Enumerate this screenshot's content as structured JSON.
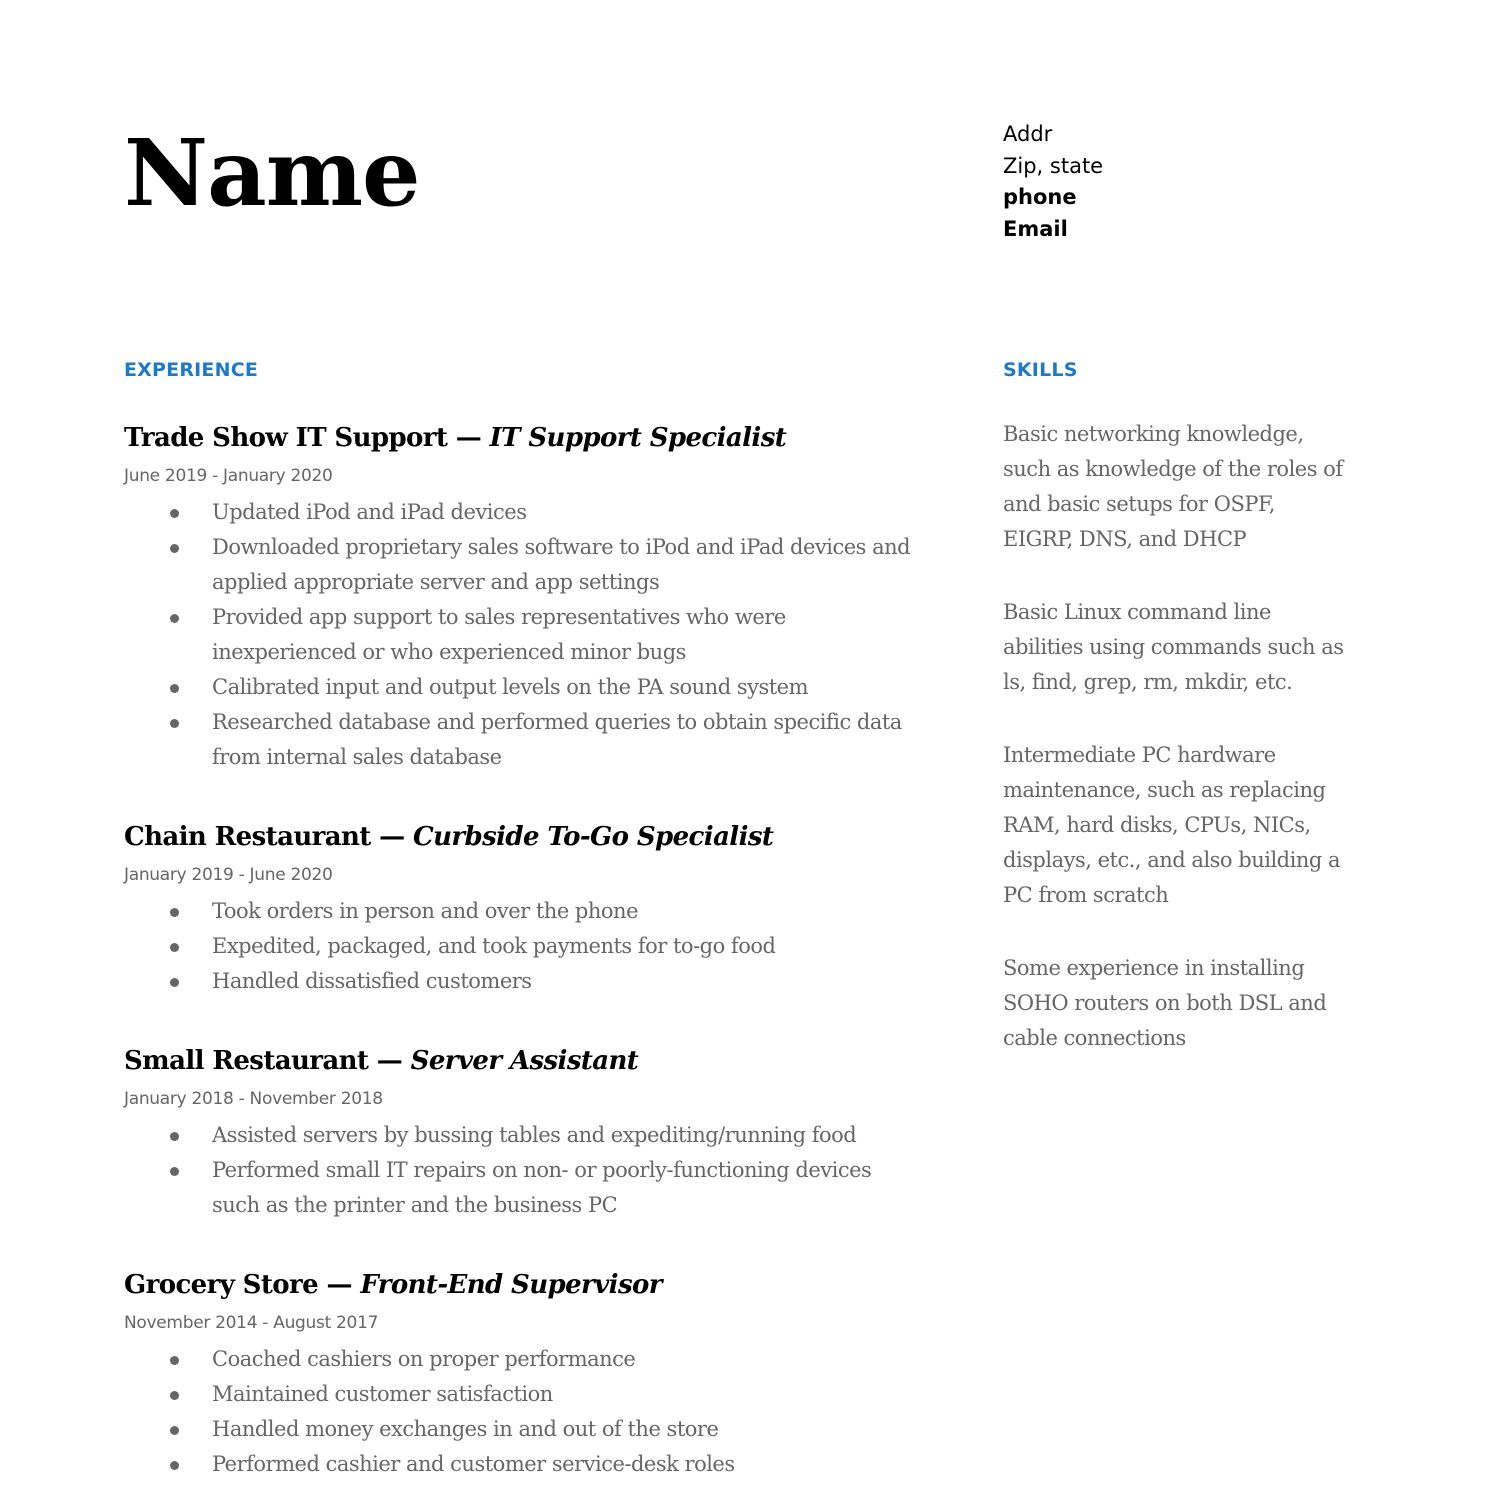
{
  "header": {
    "name": "Name",
    "contact": {
      "address": "Addr",
      "zip_state": "Zip, state",
      "phone": "phone",
      "email": "Email"
    }
  },
  "colors": {
    "accent": "#2079c7",
    "body_text": "#666666",
    "heading_text": "#000000"
  },
  "experience": {
    "heading": "EXPERIENCE",
    "separator": " — ",
    "jobs": [
      {
        "company": "Trade Show IT Support",
        "role": "IT Support Specialist",
        "dates": "June 2019 - January 2020",
        "bullets": [
          "Updated iPod and iPad devices",
          "Downloaded proprietary sales software to iPod and iPad devices and applied appropriate server and app settings",
          "Provided app support to sales representatives who were inexperienced or who experienced minor bugs",
          "Calibrated input and output levels on the PA sound system",
          "Researched database and performed queries to obtain specific data from internal sales database"
        ]
      },
      {
        "company": "Chain Restaurant",
        "role": "Curbside To-Go Specialist",
        "dates": "January 2019 - June 2020",
        "bullets": [
          "Took orders in person and over the phone",
          "Expedited, packaged, and took payments for to-go food",
          "Handled dissatisfied customers"
        ]
      },
      {
        "company": "Small Restaurant",
        "role": "Server Assistant",
        "dates": "January 2018 - November 2018",
        "bullets": [
          "Assisted servers by bussing tables and expediting/running food",
          "Performed small IT repairs on non- or poorly-functioning devices such as the printer and the business PC"
        ]
      },
      {
        "company": "Grocery Store",
        "role": "Front-End Supervisor",
        "dates": "November 2014 - August 2017",
        "bullets": [
          "Coached cashiers on proper performance",
          "Maintained customer satisfaction",
          "Handled money exchanges in and out of the store",
          "Performed cashier and customer service-desk roles"
        ]
      }
    ]
  },
  "skills": {
    "heading": "SKILLS",
    "items": [
      "Basic networking knowledge, such as knowledge of the roles of and basic setups for OSPF, EIGRP, DNS, and DHCP",
      "Basic Linux command line abilities using commands such as ls, find, grep, rm, mkdir, etc.",
      "Intermediate PC hardware maintenance, such as replacing RAM, hard disks, CPUs, NICs, displays, etc., and also building a PC from scratch",
      "Some experience in installing SOHO routers on both DSL and cable connections"
    ]
  }
}
